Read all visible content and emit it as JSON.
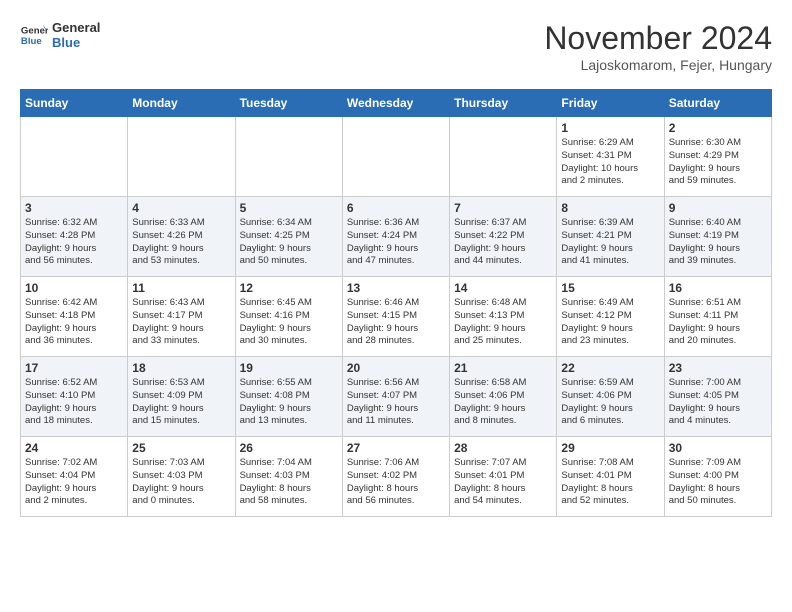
{
  "header": {
    "logo_line1": "General",
    "logo_line2": "Blue",
    "month": "November 2024",
    "location": "Lajoskomarom, Fejer, Hungary"
  },
  "weekdays": [
    "Sunday",
    "Monday",
    "Tuesday",
    "Wednesday",
    "Thursday",
    "Friday",
    "Saturday"
  ],
  "weeks": [
    [
      {
        "day": "",
        "info": ""
      },
      {
        "day": "",
        "info": ""
      },
      {
        "day": "",
        "info": ""
      },
      {
        "day": "",
        "info": ""
      },
      {
        "day": "",
        "info": ""
      },
      {
        "day": "1",
        "info": "Sunrise: 6:29 AM\nSunset: 4:31 PM\nDaylight: 10 hours\nand 2 minutes."
      },
      {
        "day": "2",
        "info": "Sunrise: 6:30 AM\nSunset: 4:29 PM\nDaylight: 9 hours\nand 59 minutes."
      }
    ],
    [
      {
        "day": "3",
        "info": "Sunrise: 6:32 AM\nSunset: 4:28 PM\nDaylight: 9 hours\nand 56 minutes."
      },
      {
        "day": "4",
        "info": "Sunrise: 6:33 AM\nSunset: 4:26 PM\nDaylight: 9 hours\nand 53 minutes."
      },
      {
        "day": "5",
        "info": "Sunrise: 6:34 AM\nSunset: 4:25 PM\nDaylight: 9 hours\nand 50 minutes."
      },
      {
        "day": "6",
        "info": "Sunrise: 6:36 AM\nSunset: 4:24 PM\nDaylight: 9 hours\nand 47 minutes."
      },
      {
        "day": "7",
        "info": "Sunrise: 6:37 AM\nSunset: 4:22 PM\nDaylight: 9 hours\nand 44 minutes."
      },
      {
        "day": "8",
        "info": "Sunrise: 6:39 AM\nSunset: 4:21 PM\nDaylight: 9 hours\nand 41 minutes."
      },
      {
        "day": "9",
        "info": "Sunrise: 6:40 AM\nSunset: 4:19 PM\nDaylight: 9 hours\nand 39 minutes."
      }
    ],
    [
      {
        "day": "10",
        "info": "Sunrise: 6:42 AM\nSunset: 4:18 PM\nDaylight: 9 hours\nand 36 minutes."
      },
      {
        "day": "11",
        "info": "Sunrise: 6:43 AM\nSunset: 4:17 PM\nDaylight: 9 hours\nand 33 minutes."
      },
      {
        "day": "12",
        "info": "Sunrise: 6:45 AM\nSunset: 4:16 PM\nDaylight: 9 hours\nand 30 minutes."
      },
      {
        "day": "13",
        "info": "Sunrise: 6:46 AM\nSunset: 4:15 PM\nDaylight: 9 hours\nand 28 minutes."
      },
      {
        "day": "14",
        "info": "Sunrise: 6:48 AM\nSunset: 4:13 PM\nDaylight: 9 hours\nand 25 minutes."
      },
      {
        "day": "15",
        "info": "Sunrise: 6:49 AM\nSunset: 4:12 PM\nDaylight: 9 hours\nand 23 minutes."
      },
      {
        "day": "16",
        "info": "Sunrise: 6:51 AM\nSunset: 4:11 PM\nDaylight: 9 hours\nand 20 minutes."
      }
    ],
    [
      {
        "day": "17",
        "info": "Sunrise: 6:52 AM\nSunset: 4:10 PM\nDaylight: 9 hours\nand 18 minutes."
      },
      {
        "day": "18",
        "info": "Sunrise: 6:53 AM\nSunset: 4:09 PM\nDaylight: 9 hours\nand 15 minutes."
      },
      {
        "day": "19",
        "info": "Sunrise: 6:55 AM\nSunset: 4:08 PM\nDaylight: 9 hours\nand 13 minutes."
      },
      {
        "day": "20",
        "info": "Sunrise: 6:56 AM\nSunset: 4:07 PM\nDaylight: 9 hours\nand 11 minutes."
      },
      {
        "day": "21",
        "info": "Sunrise: 6:58 AM\nSunset: 4:06 PM\nDaylight: 9 hours\nand 8 minutes."
      },
      {
        "day": "22",
        "info": "Sunrise: 6:59 AM\nSunset: 4:06 PM\nDaylight: 9 hours\nand 6 minutes."
      },
      {
        "day": "23",
        "info": "Sunrise: 7:00 AM\nSunset: 4:05 PM\nDaylight: 9 hours\nand 4 minutes."
      }
    ],
    [
      {
        "day": "24",
        "info": "Sunrise: 7:02 AM\nSunset: 4:04 PM\nDaylight: 9 hours\nand 2 minutes."
      },
      {
        "day": "25",
        "info": "Sunrise: 7:03 AM\nSunset: 4:03 PM\nDaylight: 9 hours\nand 0 minutes."
      },
      {
        "day": "26",
        "info": "Sunrise: 7:04 AM\nSunset: 4:03 PM\nDaylight: 8 hours\nand 58 minutes."
      },
      {
        "day": "27",
        "info": "Sunrise: 7:06 AM\nSunset: 4:02 PM\nDaylight: 8 hours\nand 56 minutes."
      },
      {
        "day": "28",
        "info": "Sunrise: 7:07 AM\nSunset: 4:01 PM\nDaylight: 8 hours\nand 54 minutes."
      },
      {
        "day": "29",
        "info": "Sunrise: 7:08 AM\nSunset: 4:01 PM\nDaylight: 8 hours\nand 52 minutes."
      },
      {
        "day": "30",
        "info": "Sunrise: 7:09 AM\nSunset: 4:00 PM\nDaylight: 8 hours\nand 50 minutes."
      }
    ]
  ]
}
